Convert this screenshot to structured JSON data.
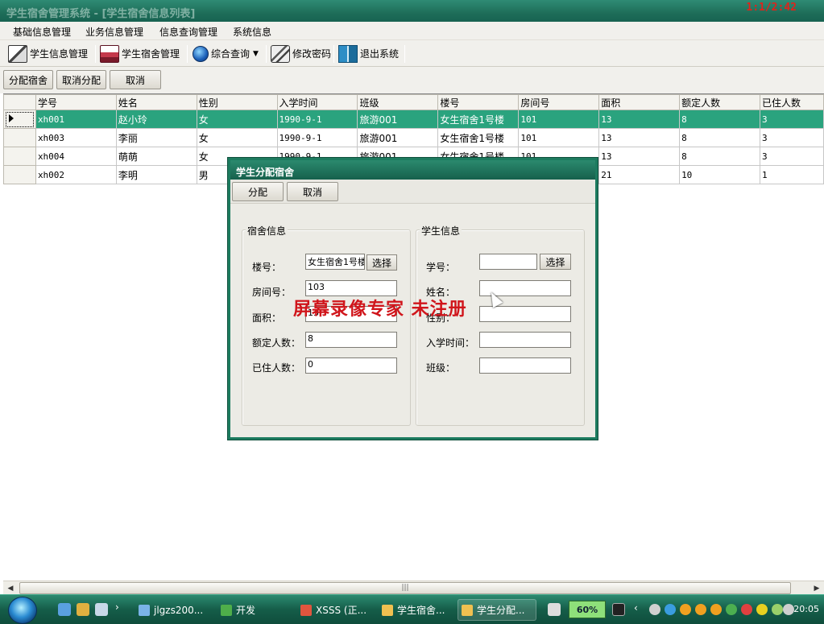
{
  "window": {
    "title": "学生宿舍管理系统 - [学生宿舍信息列表]",
    "recorder_time": "1:1/2:42"
  },
  "menu": [
    "基础信息管理",
    "业务信息管理",
    "信息查询管理",
    "系统信息"
  ],
  "toolbar": {
    "student_info": "学生信息管理",
    "dorm_mgmt": "学生宿舍管理",
    "query": "综合查询",
    "change_pwd": "修改密码",
    "exit": "退出系统"
  },
  "actions": {
    "assign": "分配宿舍",
    "unassign": "取消分配",
    "cancel": "取消"
  },
  "grid": {
    "columns": [
      "学号",
      "姓名",
      "性别",
      "入学时间",
      "班级",
      "楼号",
      "房间号",
      "面积",
      "额定人数",
      "已住人数"
    ],
    "rows": [
      [
        "xh001",
        "赵小玲",
        "女",
        "1990-9-1",
        "旅游001",
        "女生宿舍1号楼",
        "101",
        "13",
        "8",
        "3"
      ],
      [
        "xh003",
        "李丽",
        "女",
        "1990-9-1",
        "旅游001",
        "女生宿舍1号楼",
        "101",
        "13",
        "8",
        "3"
      ],
      [
        "xh004",
        "萌萌",
        "女",
        "1990-9-1",
        "旅游001",
        "女生宿舍1号楼",
        "101",
        "13",
        "8",
        "3"
      ],
      [
        "xh002",
        "李明",
        "男",
        "",
        "",
        "",
        "",
        "21",
        "10",
        "1"
      ]
    ]
  },
  "dialog": {
    "title": "学生分配宿舍",
    "assign": "分配",
    "cancel": "取消",
    "dorm_group": "宿舍信息",
    "student_group": "学生信息",
    "building_label": "楼号：",
    "building_value": "女生宿舍1号楼",
    "select_building": "选择",
    "room_label": "房间号：",
    "room_value": "103",
    "area_label": "面积：",
    "area_value": "13",
    "capacity_label": "额定人数：",
    "capacity_value": "8",
    "occupied_label": "已住人数：",
    "occupied_value": "0",
    "sid_label": "学号：",
    "select_student": "选择",
    "name_label": "姓名：",
    "gender_label": "性别：",
    "enroll_label": "入学时间：",
    "class_label": "班级："
  },
  "watermark": "屏幕录像专家  未注册",
  "taskbar": {
    "tasks": [
      "jlgzs200...",
      "开发",
      "XSSS (正...",
      "学生宿舍...",
      "学生分配..."
    ],
    "battery": "60%",
    "clock": "20:05"
  }
}
